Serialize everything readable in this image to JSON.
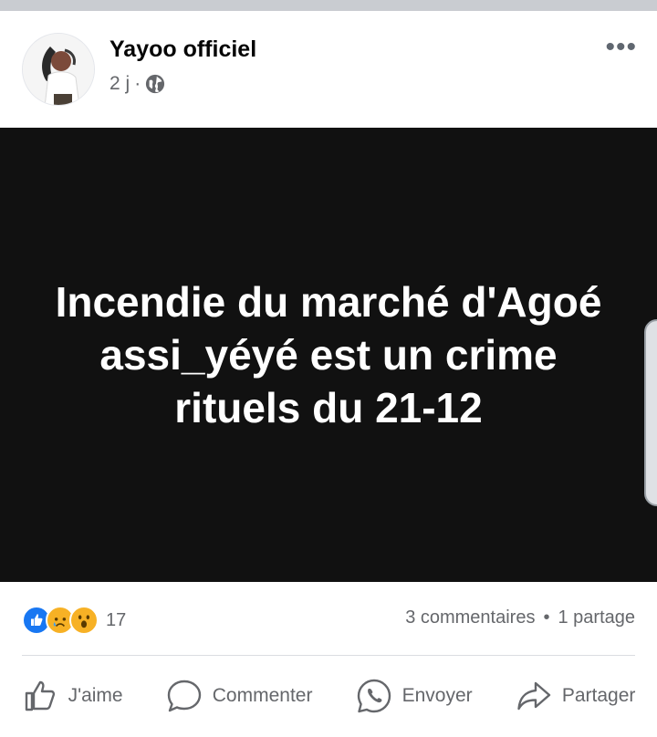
{
  "post": {
    "author": "Yayoo officiel",
    "time": "2 j",
    "dot": "·",
    "media_text": "Incendie du marché d'Agoé assi_yéyé est un crime rituels du 21-12",
    "more_glyph": "•••"
  },
  "stats": {
    "reaction_count": "17",
    "comments": "3 commentaires",
    "separator": "•",
    "shares": "1 partage"
  },
  "actions": {
    "like": "J'aime",
    "comment": "Commenter",
    "send": "Envoyer",
    "share": "Partager"
  },
  "icons": {
    "globe": "globe-icon",
    "reactions": [
      "like-reaction-icon",
      "sad-reaction-icon",
      "wow-reaction-icon"
    ],
    "more": "more-options-icon"
  },
  "colors": {
    "brand_blue": "#1877f2",
    "reaction_yellow": "#f7b125",
    "media_bg": "#111111",
    "secondary_text": "#65676b"
  }
}
